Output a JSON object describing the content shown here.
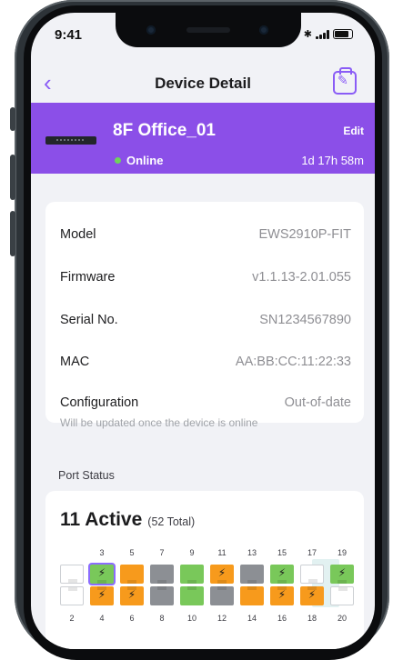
{
  "status_bar": {
    "time": "9:41"
  },
  "nav": {
    "title": "Device Detail"
  },
  "device": {
    "name": "8F Office_01",
    "edit_label": "Edit",
    "status": "Online",
    "uptime": "1d 17h 58m"
  },
  "info": {
    "rows": [
      {
        "label": "Model",
        "value": "EWS2910P-FIT"
      },
      {
        "label": "Firmware",
        "value": "v1.1.13-2.01.055"
      },
      {
        "label": "Serial No.",
        "value": "SN1234567890"
      },
      {
        "label": "MAC",
        "value": "AA:BB:CC:11:22:33"
      },
      {
        "label": "Configuration",
        "value": "Out-of-date"
      }
    ],
    "config_note": "Will be updated once the device is online"
  },
  "ports": {
    "section_title": "Port Status",
    "active_label": "11 Active",
    "total_label": "(52 Total)",
    "top_numbers": [
      "3",
      "5",
      "7",
      "9",
      "11",
      "13",
      "15",
      "17",
      "19"
    ],
    "bottom_numbers": [
      "2",
      "4",
      "6",
      "8",
      "10",
      "12",
      "14",
      "16",
      "18",
      "20"
    ],
    "top_row": [
      "empty",
      "green-poe",
      "orange",
      "gray",
      "green",
      "orange-poe",
      "gray",
      "green-poe",
      "empty",
      "green-poe"
    ],
    "bottom_row": [
      "empty",
      "orange-poe",
      "orange-poe",
      "gray",
      "green",
      "gray",
      "orange",
      "orange-poe",
      "orange-poe",
      "empty"
    ],
    "selected_port": "3",
    "colors": {
      "accent": "#8b4fe8",
      "link_up": "#79c85a",
      "poe": "#f79a1c",
      "disabled": "#8c8f94"
    }
  }
}
